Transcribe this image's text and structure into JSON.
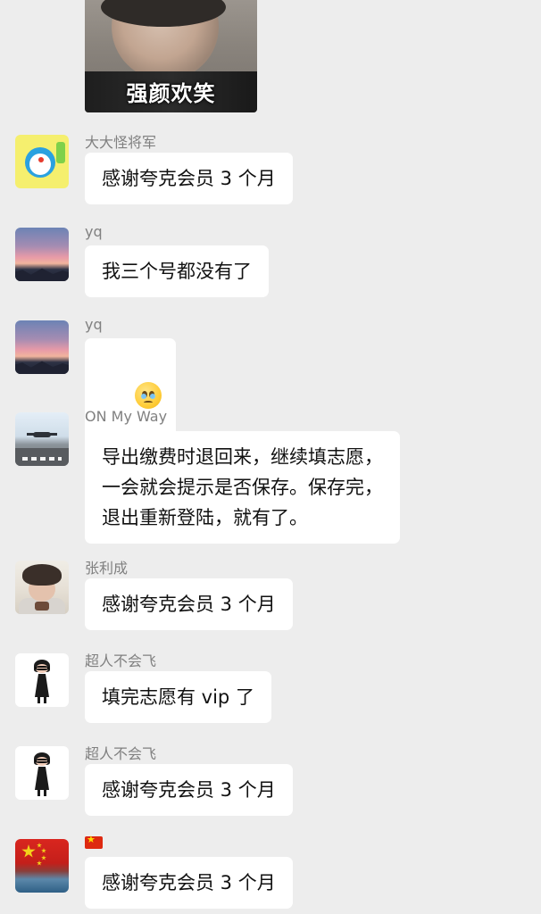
{
  "top_image": {
    "caption": "强颜欢笑"
  },
  "messages": [
    {
      "sender": "大大怪将军",
      "avatar_icon": "doraemon-avatar-icon",
      "text": "感谢夸克会员 3 个月"
    },
    {
      "sender": "yq",
      "avatar_icon": "sunset-mountain-avatar-icon",
      "text": "我三个号都没有了"
    },
    {
      "sender": "yq",
      "avatar_icon": "sunset-mountain-avatar-icon",
      "emoji": "pleading-face-icon"
    },
    {
      "sender": "ON   My  Way",
      "avatar_icon": "runway-avatar-icon",
      "text": "导出缴费时退回来，继续填志愿，\n一会就会提示是否保存。保存完，\n退出重新登陆，就有了。"
    },
    {
      "sender": "张利成",
      "avatar_icon": "person-photo-avatar-icon",
      "text": "感谢夸克会员 3 个月"
    },
    {
      "sender": "超人不会飞",
      "avatar_icon": "edna-mode-avatar-icon",
      "text": "填完志愿有 vip 了"
    },
    {
      "sender": "超人不会飞",
      "avatar_icon": "edna-mode-avatar-icon",
      "text": "感谢夸克会员 3 个月"
    },
    {
      "sender_icon": "china-flag-icon",
      "avatar_icon": "china-flag-avatar-icon",
      "text": "感谢夸克会员 3 个月"
    }
  ],
  "colors": {
    "background": "#ededed",
    "bubble": "#ffffff",
    "sender_name": "#808080",
    "message_text": "#111111"
  }
}
